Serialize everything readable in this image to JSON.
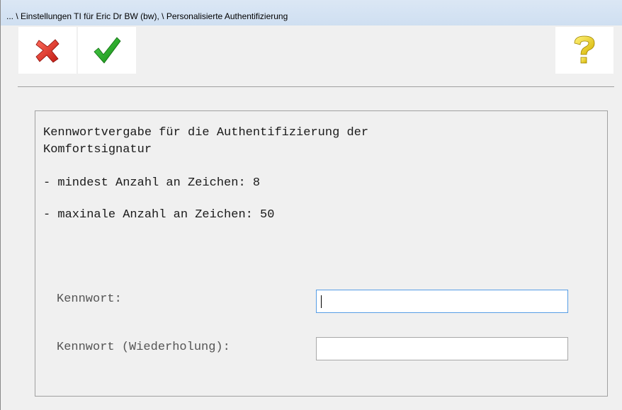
{
  "window": {
    "title": "... \\ Einstellungen TI für Eric Dr BW (bw),  \\ Personalisierte Authentifizierung"
  },
  "toolbar": {
    "cancel_icon": "close-x-icon",
    "confirm_icon": "checkmark-icon",
    "help_icon": "question-mark-icon",
    "colors": {
      "cancel": "#e0302a",
      "confirm": "#1f9e1f",
      "help": "#f5d800"
    }
  },
  "info": {
    "line1": "Kennwortvergabe für die Authentifizierung der",
    "line2": "Komfortsignatur",
    "min_chars": "- mindest Anzahl an Zeichen: 8",
    "max_chars": "- maxinale Anzahl an Zeichen: 50"
  },
  "form": {
    "password_label": "Kennwort:",
    "password_value": "",
    "password_repeat_label": "Kennwort (Wiederholung):",
    "password_repeat_value": ""
  }
}
